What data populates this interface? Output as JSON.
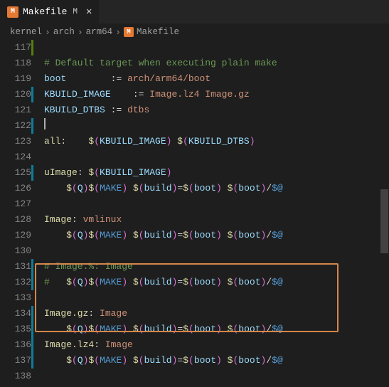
{
  "tab": {
    "icon_letter": "M",
    "label": "Makefile",
    "modified_badge": "M",
    "close_glyph": "✕"
  },
  "breadcrumb": {
    "parts": [
      "kernel",
      "arch",
      "arm64"
    ],
    "file_icon_letter": "M",
    "file": "Makefile",
    "sep": "›"
  },
  "lines": {
    "117": "",
    "118_comment": "# Default target when executing plain make",
    "119_lhs": "boot",
    "119_op": ":=",
    "119_rhs": "arch/arm64/boot",
    "120_lhs": "KBUILD_IMAGE",
    "120_op": ":=",
    "120_rhs": "Image.lz4 Image.gz",
    "121_lhs": "KBUILD_DTBS",
    "121_op": ":=",
    "121_rhs": "dtbs",
    "123_target": "all",
    "123_dep1": "KBUILD_IMAGE",
    "123_dep2": "KBUILD_DTBS",
    "125_target": "uImage",
    "125_dep": "KBUILD_IMAGE",
    "126_q": "Q",
    "126_make": "MAKE",
    "126_build": "build",
    "126_boot": "boot",
    "126_auto": "$@",
    "128_target": "Image",
    "128_dep": "vmlinux",
    "129_q": "Q",
    "129_make": "MAKE",
    "129_build": "build",
    "129_boot": "boot",
    "129_auto": "$@",
    "131_comment": "# Image.%: Image",
    "132_comment_prefix": "#   ",
    "132_q": "Q",
    "132_make": "MAKE",
    "132_build": "build",
    "132_boot": "boot",
    "132_auto": "$@",
    "134_target": "Image.gz",
    "134_dep": "Image",
    "135_q": "Q",
    "135_make": "MAKE",
    "135_build": "build",
    "135_boot": "boot",
    "135_auto": "$@",
    "136_target": "Image.lz4",
    "136_dep": "Image",
    "137_q": "Q",
    "137_make": "MAKE",
    "137_build": "build",
    "137_boot": "boot",
    "137_auto": "$@"
  },
  "line_numbers": [
    "117",
    "118",
    "119",
    "120",
    "121",
    "122",
    "123",
    "124",
    "125",
    "126",
    "127",
    "128",
    "129",
    "130",
    "131",
    "132",
    "133",
    "134",
    "135",
    "136",
    "137",
    "138"
  ],
  "gutter_markers": {
    "117": "add",
    "120": "mod",
    "122": "mod",
    "125": "mod",
    "131": "mod",
    "132": "mod",
    "134": "mod",
    "135": "mod",
    "136": "mod",
    "137": "mod"
  }
}
